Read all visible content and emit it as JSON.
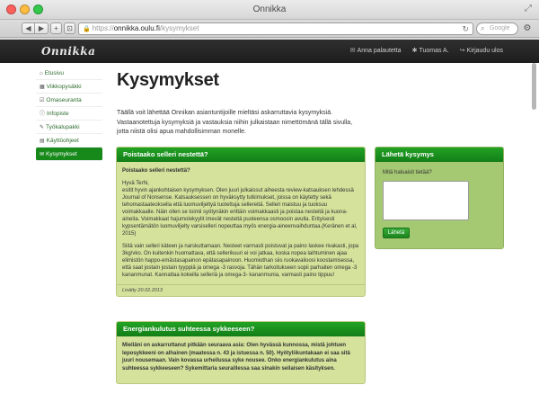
{
  "browser": {
    "window_title": "Onnikka",
    "url_scheme": "https://",
    "url_host": "onnikka.oulu.fi",
    "url_path": "/kysymykset",
    "search_placeholder": "Google",
    "icons": [
      "back-icon",
      "forward-icon",
      "add-tab-icon",
      "share-icon",
      "lock-icon",
      "reload-icon",
      "search-icon",
      "gear-icon",
      "bookmarks-icon",
      "top-sites-icon"
    ]
  },
  "navbar": {
    "brand": "Onnikka",
    "links": [
      {
        "label": "Anna palautetta",
        "icon": "envelope-icon"
      },
      {
        "label": "Tuomas A.",
        "icon": "cog-icon"
      },
      {
        "label": "Kirjaudu ulos",
        "icon": "logout-icon"
      }
    ]
  },
  "sidebar": {
    "items": [
      {
        "label": "Etusivu",
        "icon": "home-icon",
        "active": false
      },
      {
        "label": "Viikkopysäkki",
        "icon": "calendar-icon",
        "active": false
      },
      {
        "label": "Omaseuranta",
        "icon": "checkbox-icon",
        "active": false
      },
      {
        "label": "Infopiste",
        "icon": "info-icon",
        "active": false
      },
      {
        "label": "Työkalupakki",
        "icon": "wrench-icon",
        "active": false
      },
      {
        "label": "Käyttöohjeet",
        "icon": "book-icon",
        "active": false
      },
      {
        "label": "Kysymykset",
        "icon": "comments-icon",
        "active": true
      }
    ]
  },
  "main": {
    "title": "Kysymykset",
    "intro": "Täällä voit lähettää Onnikan asiantuntijoille mieltäsi askarruttavia kysymyksiä. Vastaanotettuja kysymyksiä ja vastauksia niihin julkaistaan nimettömänä tällä sivulla, jotta niistä olisi apua mahdollisimman monelle."
  },
  "questions": [
    {
      "heading": "Poistaako selleri nestettä?",
      "question": "Poistaako selleri nestettä?",
      "answer_paragraphs": [
        "Hyvä Terhi,",
        "esitit hyvin ajankohtaisen kysymyksen. Olen juuri julkaissut aiheesta review-katsauksen lehdessä Journal of Nonsense. Katsauksessen on hyväksytty tutkimukset, joissa on käytetty sekä tehomastaateoksella että luomuviljeltyä tuotettuja sellereitä. Selleri maistuu ja tuoksuu voimakkaalle. Näin ollen se toimii syötynäkin erittäin voimakkaasti ja poistaa nesteitä ja kuona-aineita. Voimakkaat hajumolekyylit imevät nesteitä puoleensa osmoosin avulla. Erityisesti kypsentämätön luomuviljelty varsiselleri nopeuttaa myös energia-aineenvaihduntaa.(Keränen et al, 2015)",
        "Siitä vain selleri käteen ja narskuttamaan. Nesteet varmasti poistuvat ja paino laskee rivakasti, jopa 3kg/vko. On kuitenkin huomattava, että sellerikuuri ei voi jatkaa, koska nopea laihtuminen ajaa elimistön happo-emästasapainon epätasapainoon. Huomiothan siis ruokavalioosi koostamisessa, että saat jostain jostain tyyppiä ja omega -3 rasvoja. Tähän tarkoitukseen sopii parhaiten omega -3 kananmunat. Kannattaa kokeilla selleriä ja omega-3- kananmunia, varmasti paino tippuu!"
      ],
      "date": "Lisätty 20.02.2013"
    },
    {
      "heading": "Energiankulutus suhteessa sykkeeseen?",
      "question": "Mielläni on askarruttanut pitkään seuraava asia: Olen hyvässä kunnossa, mistä johtuen leposykkeeni on alhainen (maatessa n. 43 ja istuessa n. 50). Hyötyliikuntakaan ei saa sitä juuri nousemaan. Vain kovassa urheilussa syke nousee. Onko energiankulutus aina suhteessa sykkeeseen? Sykemittaria seuraillessa saa sinakin seilaisen käsityksen."
    }
  ],
  "send_box": {
    "heading": "Lähetä kysymys",
    "label": "Mitä haluaisit tietää?",
    "textarea_value": "",
    "button": "Lähetä"
  },
  "colors": {
    "accent_green": "#17891a",
    "question_bg": "#d4e29c",
    "send_bg": "#a5c873",
    "navbar_bg": "#232323"
  }
}
